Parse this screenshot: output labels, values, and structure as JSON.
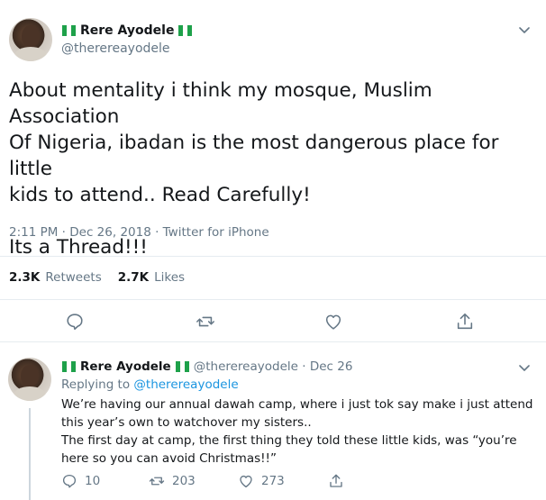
{
  "main_tweet": {
    "author_name": "Rere Ayodele",
    "handle": "@therereayodele",
    "text_lines": [
      "About mentality i think my mosque, Muslim Association",
      "Of Nigeria, ibadan is the most dangerous place for little",
      "kids to attend.. Read Carefully!"
    ],
    "text_line_2": "Its a Thread!!!",
    "meta": "2:11 PM · Dec 26, 2018 · Twitter for iPhone",
    "retweets_count": "2.3K",
    "retweets_label": "Retweets",
    "likes_count": "2.7K",
    "likes_label": "Likes"
  },
  "reply": {
    "author_name": "Rere Ayodele",
    "handle_date": "@therereayodele · Dec 26",
    "replying_prefix": "Replying to",
    "replying_to": "@therereayodele",
    "text_lines": [
      "We’re having our annual dawah camp, where i just tok say make i just attend",
      "this year’s own to watchover my sisters..",
      "The first day at camp, the first thing they told these little kids, was “you’re",
      "here so you can avoid Christmas!!”"
    ],
    "replies": "10",
    "retweets": "203",
    "likes": "273"
  },
  "colors": {
    "text": "#14171a",
    "muted": "#657786",
    "link": "#1b95e0",
    "divider": "#e6ecf0",
    "flag_green": "#1ea14a"
  },
  "icons": [
    "reply-icon",
    "retweet-icon",
    "like-icon",
    "share-icon",
    "chevron-down-icon",
    "nigeria-flag-icon"
  ]
}
